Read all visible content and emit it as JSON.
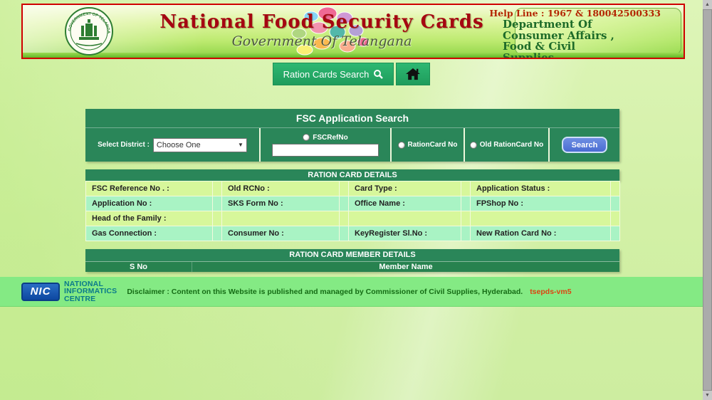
{
  "header": {
    "help_line": "Help Line : 1967 & 180042500333",
    "title": "National Food Security Cards",
    "subtitle": "Government Of Telangana",
    "department_lines": [
      "Department Of",
      "Consumer Affairs ,",
      "Food & Civil",
      "Supplies"
    ],
    "emblem_text": "GOVERNMENT OF TELANGANA"
  },
  "nav": {
    "search_button_label": "Ration Cards Search",
    "home_icon": "home"
  },
  "search_panel": {
    "title": "FSC Application Search",
    "district_label": "Select District :",
    "district_value": "Choose One",
    "dropdown_arrow": "▼",
    "radio_fscrefno": "FSCRefNo",
    "radio_rationcard": "RationCard No",
    "radio_old_rationcard": "Old RationCard No",
    "search_button_label": "Search"
  },
  "card_details": {
    "title": "RATION CARD DETAILS",
    "rows": [
      [
        "FSC Reference No . :",
        "Old RCNo :",
        "Card Type :",
        "Application Status :"
      ],
      [
        "Application No :",
        "SKS Form No :",
        "Office Name :",
        "FPShop No :"
      ],
      [
        "Head of the Family :",
        "",
        "",
        ""
      ],
      [
        "Gas Connection :",
        "Consumer No :",
        "KeyRegister Sl.No :",
        "New Ration Card No :"
      ]
    ]
  },
  "member_details": {
    "title": "RATION CARD MEMBER DETAILS",
    "col_sno": "S No",
    "col_member": "Member Name"
  },
  "footer": {
    "nic_logo": "NIC",
    "nic_lines": [
      "NATIONAL",
      "INFORMATICS",
      "CENTRE"
    ],
    "disclaimer": "Disclaimer : Content on this Website is published and managed by Commissioner of Civil Supplies, Hyderabad.",
    "server": "tsepds-vm5"
  },
  "scrollbar": {
    "up_arrow": "▲",
    "down_arrow": "▼"
  },
  "colors": {
    "panel_green": "#2a8659",
    "nav_green": "#26ad67",
    "button_blue": "#4a6cd2",
    "header_border_red": "#cf0000",
    "row_yellow_green": "#d7f79b",
    "row_mint_green": "#a9f3c4",
    "footer_green": "#84ea84",
    "title_red": "#a50611",
    "dept_green": "#1d6b28",
    "nic_teal": "#0a7a8a",
    "server_red": "#dd4411"
  }
}
